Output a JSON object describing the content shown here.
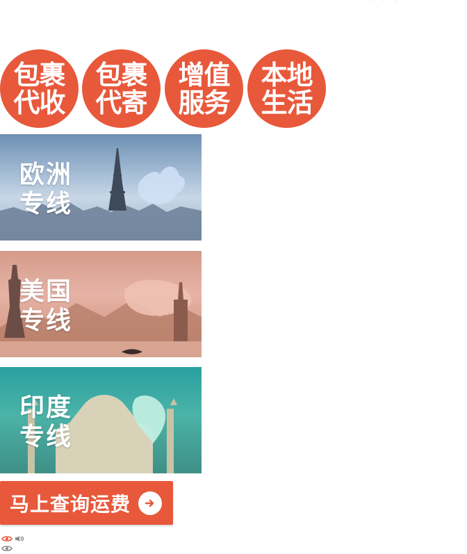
{
  "services": [
    {
      "label": "包裹\n代收"
    },
    {
      "label": "包裹\n代寄"
    },
    {
      "label": "增值\n服务"
    },
    {
      "label": "本地\n生活"
    }
  ],
  "banners": [
    {
      "title": "欧洲\n专线"
    },
    {
      "title": "美国\n专线"
    },
    {
      "title": "印度\n专线"
    }
  ],
  "cta": {
    "label": "马上查询运费"
  },
  "icons": {
    "visibility": "eye-icon",
    "audio": "speaker-icon"
  },
  "colors": {
    "accent": "#e8583b"
  }
}
